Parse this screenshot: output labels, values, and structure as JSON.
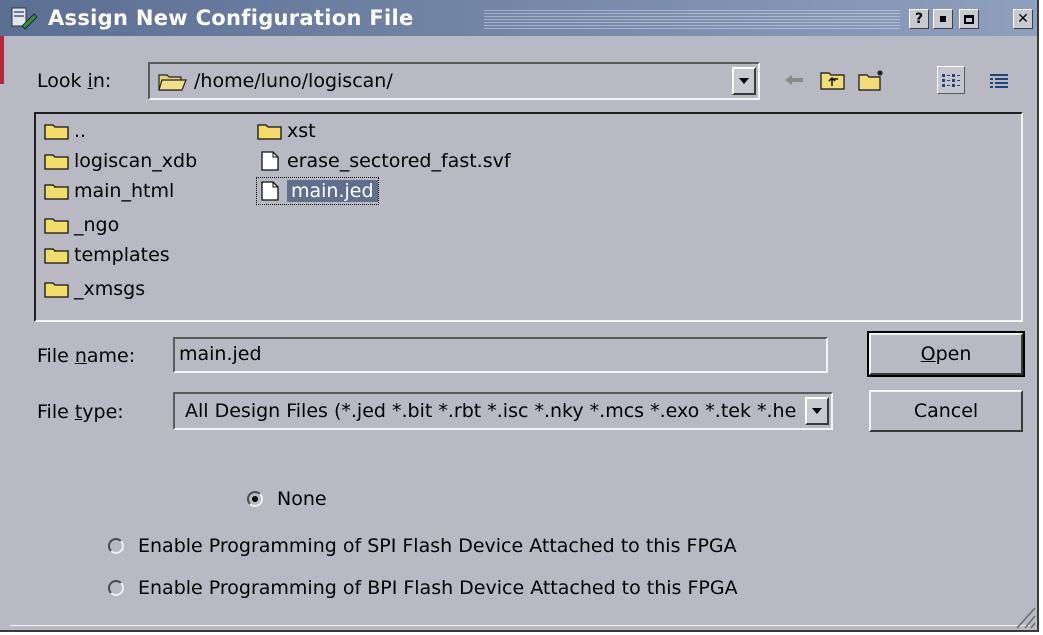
{
  "window": {
    "title": "Assign New Configuration File",
    "help": "?",
    "close": "✕"
  },
  "lookin": {
    "label_prefix": "Look ",
    "label_accel": "i",
    "label_suffix": "n:",
    "path": "/home/luno/logiscan/"
  },
  "files": {
    "col1": [
      {
        "name": "..",
        "type": "folder"
      },
      {
        "name": "logiscan_xdb",
        "type": "folder"
      },
      {
        "name": "main_html",
        "type": "folder"
      },
      {
        "name": "_ngo",
        "type": "folder"
      },
      {
        "name": "templates",
        "type": "folder"
      },
      {
        "name": "_xmsgs",
        "type": "folder"
      }
    ],
    "col2": [
      {
        "name": "xst",
        "type": "folder"
      },
      {
        "name": "erase_sectored_fast.svf",
        "type": "file"
      },
      {
        "name": "main.jed",
        "type": "file",
        "selected": true
      }
    ]
  },
  "filename": {
    "label_prefix": "File ",
    "label_accel": "n",
    "label_suffix": "ame:",
    "value": "main.jed"
  },
  "filetype": {
    "label_prefix": "File ",
    "label_accel": "t",
    "label_suffix": "ype:",
    "value": "All Design Files (*.jed *.bit *.rbt *.isc *.nky *.mcs *.exo *.tek *.hex)"
  },
  "buttons": {
    "open_accel": "O",
    "open_rest": "pen",
    "cancel": "Cancel"
  },
  "options": {
    "none": "None",
    "spi": "Enable Programming of SPI Flash Device Attached to this FPGA",
    "bpi": "Enable Programming of BPI Flash Device Attached to this FPGA",
    "selected": "none"
  }
}
